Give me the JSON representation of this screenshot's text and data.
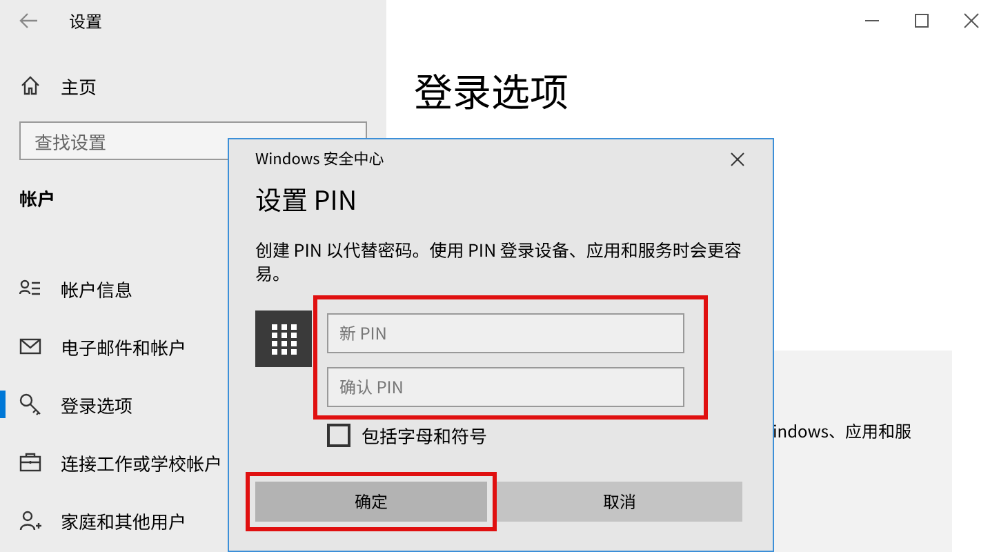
{
  "window": {
    "title": "设置"
  },
  "sidebar": {
    "home": "主页",
    "search": {
      "placeholder": "查找设置"
    },
    "section": "帐户",
    "items": [
      {
        "label": "帐户信息",
        "kind": "person-list",
        "selected": false
      },
      {
        "label": "电子邮件和帐户",
        "kind": "mail",
        "selected": false
      },
      {
        "label": "登录选项",
        "kind": "key",
        "selected": true
      },
      {
        "label": "连接工作或学校帐户",
        "kind": "briefcase",
        "selected": false
      },
      {
        "label": "家庭和其他用户",
        "kind": "person-add",
        "selected": false
      }
    ]
  },
  "main": {
    "heading": "登录选项",
    "card_text": "indows、应用和服"
  },
  "dialog": {
    "app": "Windows 安全中心",
    "title": "设置 PIN",
    "description": "创建 PIN 以代替密码。使用 PIN 登录设备、应用和服务时会更容易。",
    "fields": [
      {
        "placeholder": "新 PIN"
      },
      {
        "placeholder": "确认 PIN"
      }
    ],
    "checkbox": {
      "label": "包括字母和符号",
      "checked": false
    },
    "buttons": [
      {
        "label": "确定",
        "selected": true
      },
      {
        "label": "取消",
        "selected": false
      }
    ]
  }
}
